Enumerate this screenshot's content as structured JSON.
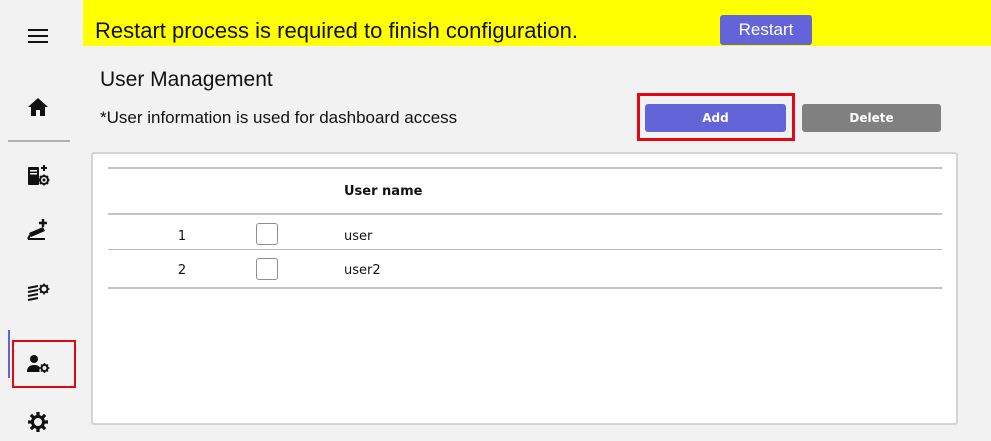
{
  "sidebar": {
    "items": [
      {
        "icon": "menu-icon"
      },
      {
        "icon": "home-icon"
      },
      {
        "icon": "server-settings-icon"
      },
      {
        "icon": "camera-add-icon"
      },
      {
        "icon": "rule-settings-icon"
      },
      {
        "icon": "user-settings-icon",
        "active": true
      },
      {
        "icon": "gear-icon"
      }
    ]
  },
  "banner": {
    "message": "Restart process is required to finish configuration.",
    "restart_label": "Restart"
  },
  "main": {
    "title": "User Management",
    "note": "*User information is used for dashboard access",
    "add_label": "Add",
    "delete_label": "Delete"
  },
  "table": {
    "columns": [
      "",
      "",
      "User name"
    ],
    "rows": [
      {
        "index": "1",
        "username": "user"
      },
      {
        "index": "2",
        "username": "user2"
      }
    ]
  },
  "colors": {
    "accent": "#6264d8",
    "banner": "#ffff00",
    "highlight": "#e30613",
    "secondary_button": "#808080"
  }
}
